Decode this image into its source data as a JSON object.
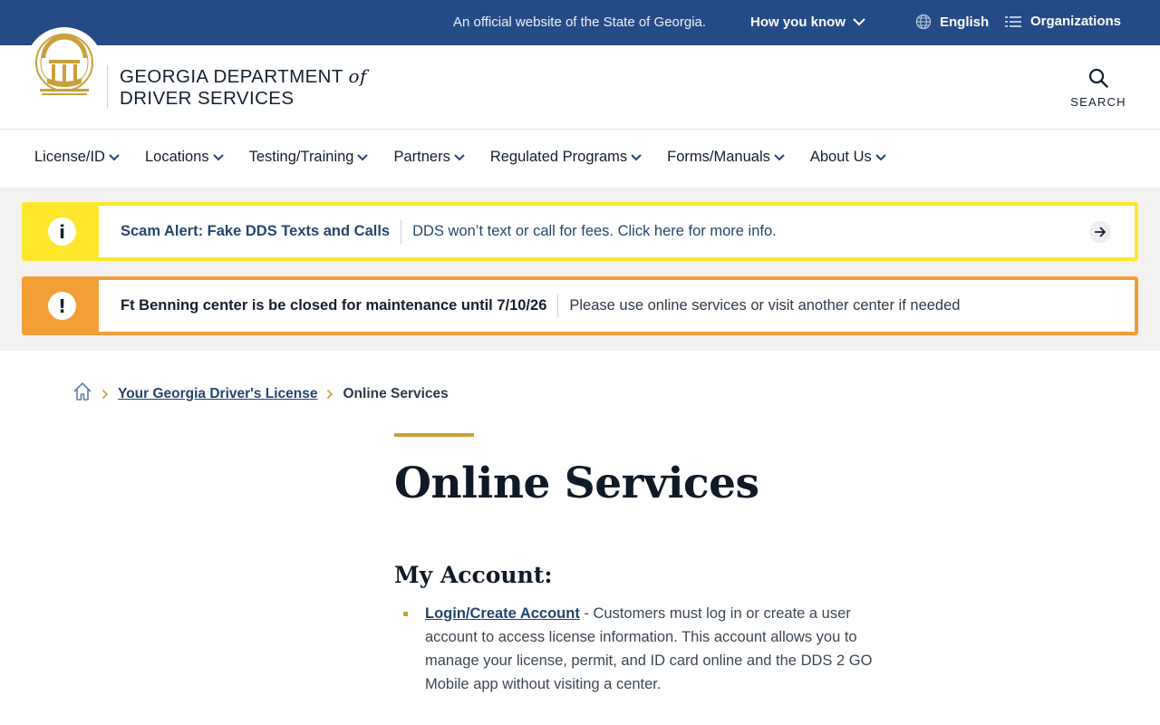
{
  "topbar": {
    "official_text": "An official website of the State of Georgia.",
    "how_you_know": "How you know",
    "language": "English",
    "organizations": "Organizations"
  },
  "header": {
    "brand_line1": "GEORGIA DEPARTMENT",
    "brand_of": "of",
    "brand_line2": "DRIVER SERVICES",
    "search_label": "SEARCH"
  },
  "nav": {
    "items": [
      {
        "label": "License/ID"
      },
      {
        "label": "Locations"
      },
      {
        "label": "Testing/Training"
      },
      {
        "label": "Partners"
      },
      {
        "label": "Regulated Programs"
      },
      {
        "label": "Forms/Manuals"
      },
      {
        "label": "About Us"
      }
    ]
  },
  "alerts": [
    {
      "icon": "i",
      "title": "Scam Alert: Fake DDS Texts and Calls",
      "description": "DDS won’t text or call for fees. Click here for more info.",
      "color": "#fde82d"
    },
    {
      "icon": "!",
      "title": "Ft Benning center is be closed for maintenance until 7/10/26",
      "description": "Please use online services or visit another center if needed",
      "color": "#f29f38"
    }
  ],
  "breadcrumb": {
    "parent": "Your Georgia Driver's License",
    "current": "Online Services"
  },
  "content": {
    "title": "Online Services",
    "section_title": "My Account:",
    "items": [
      {
        "link": "Login/Create Account",
        "text": " - Customers must log in or create a user account to access license information.  This account allows you to manage your license, permit, and ID card online and the DDS 2 GO Mobile app without visiting a center."
      }
    ]
  },
  "colors": {
    "topbar": "#254b87",
    "accent_gold": "#c9a13b",
    "link": "#25456e"
  }
}
